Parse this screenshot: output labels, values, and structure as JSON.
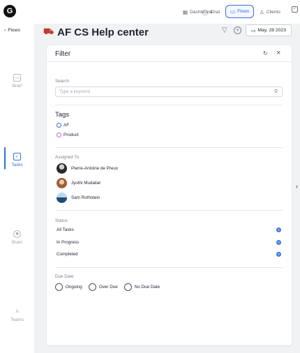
{
  "brand": {
    "logo_glyph": "G"
  },
  "nav": {
    "items": [
      {
        "label": "Dashboard",
        "icon": "grid-icon"
      },
      {
        "label": "Chat",
        "icon": "chat-icon"
      },
      {
        "label": "Flows",
        "icon": "flows-icon",
        "active": true
      },
      {
        "label": "Clients",
        "icon": "users-icon"
      }
    ]
  },
  "rail": {
    "back_label": "Flows",
    "items": [
      {
        "label": "Brief",
        "icon": "document-icon"
      },
      {
        "label": "Tasks",
        "icon": "checkbox-icon",
        "active": true
      },
      {
        "label": "Brain",
        "icon": "brain-icon"
      },
      {
        "label": "Teams",
        "icon": "team-icon"
      }
    ]
  },
  "header": {
    "title": "AF CS Help center",
    "date": "May, 28 2023"
  },
  "filter": {
    "title": "Filter",
    "search": {
      "label": "Search",
      "placeholder": "Type a keyword"
    },
    "tags": {
      "title": "Tags",
      "items": [
        {
          "label": "AF",
          "color": "#2f6fde"
        },
        {
          "label": "Product",
          "color": "#c06ac8"
        }
      ]
    },
    "assigned": {
      "label": "Assigned To",
      "people": [
        {
          "name": "Pierre-Antoine de Preux"
        },
        {
          "name": "Jyothi Mudaliar"
        },
        {
          "name": "Sam Rothstein"
        }
      ]
    },
    "status": {
      "label": "Status",
      "items": [
        {
          "label": "All Tasks",
          "count": "0"
        },
        {
          "label": "In Progress",
          "count": "0"
        },
        {
          "label": "Completed",
          "count": "0"
        }
      ]
    },
    "due": {
      "label": "Due Date",
      "options": [
        "Ongoing",
        "Over Due",
        "No Due Date"
      ]
    }
  },
  "colors": {
    "accent": "#2f6fde",
    "badge": "#3b7be3",
    "background": "#f1f2f4"
  }
}
